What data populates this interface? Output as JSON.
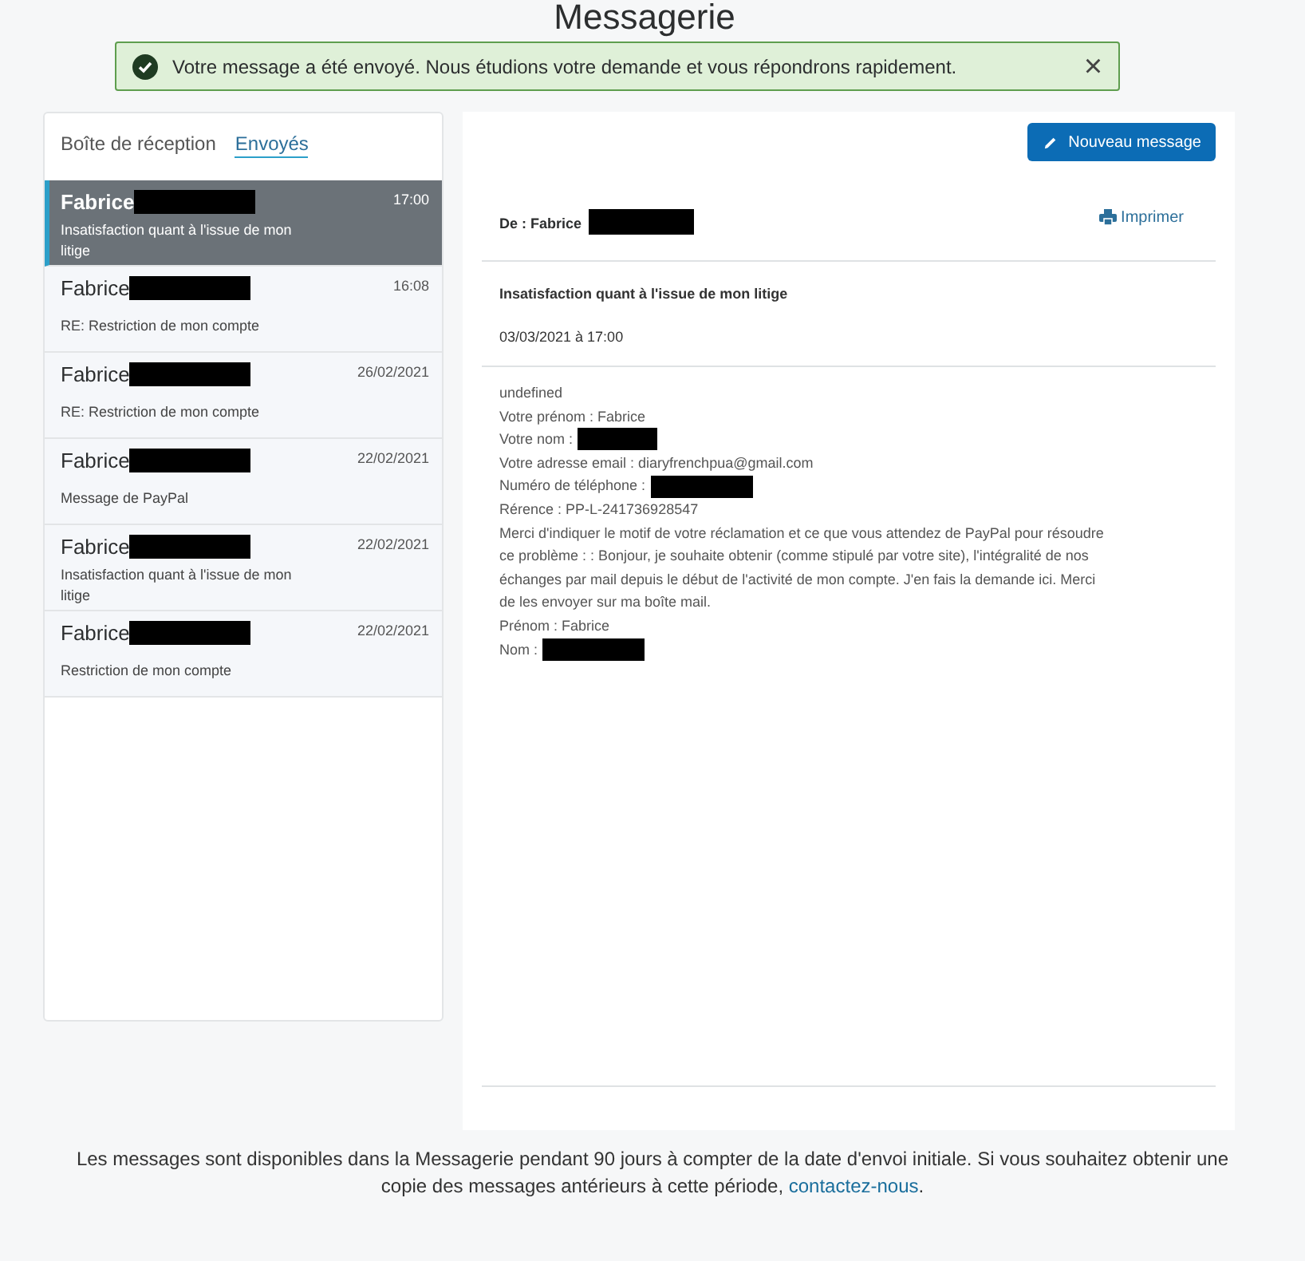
{
  "page": {
    "title": "Messagerie"
  },
  "banner": {
    "text": "Votre message a été envoyé. Nous étudions votre demande et vous répondrons rapidement.",
    "close": "×"
  },
  "tabs": [
    {
      "label": "Boîte de réception",
      "selected": false
    },
    {
      "label": "Envoyés",
      "selected": true
    }
  ],
  "messages": [
    {
      "sender": "Fabrice",
      "redacted": true,
      "time": "17:00",
      "subject": "Insatisfaction quant à l'issue de mon litige",
      "selected": true
    },
    {
      "sender": "Fabrice",
      "redacted": true,
      "time": "16:08",
      "subject": "RE: Restriction de mon compte",
      "selected": false
    },
    {
      "sender": "Fabrice",
      "redacted": true,
      "time": "26/02/2021",
      "subject": "RE: Restriction de mon compte",
      "selected": false
    },
    {
      "sender": "Fabrice",
      "redacted": true,
      "time": "22/02/2021",
      "subject": "Message de PayPal",
      "selected": false
    },
    {
      "sender": "Fabrice",
      "redacted": true,
      "time": "22/02/2021",
      "subject": "Insatisfaction quant à l'issue de mon litige",
      "selected": false
    },
    {
      "sender": "Fabrice",
      "redacted": true,
      "time": "22/02/2021",
      "subject": "Restriction de mon compte",
      "selected": false
    }
  ],
  "new_message_button": "Nouveau message",
  "message": {
    "from": "De : Fabrice",
    "from_redacted": true,
    "print": "Imprimer",
    "subject": "Insatisfaction quant à l'issue de mon litige",
    "date": "03/03/2021 à 17:00",
    "body": [
      {
        "text": "undefined",
        "redacted": false
      },
      {
        "text": "Votre prénom : Fabrice",
        "redacted": false
      },
      {
        "text": "Votre nom :",
        "redacted": true
      },
      {
        "text": "Votre adresse email : diaryfrenchpua@gmail.com",
        "redacted": false
      },
      {
        "text": "Numéro de téléphone :",
        "redacted": true
      },
      {
        "text": "Rérence : PP-L-241736928547",
        "redacted": false
      },
      {
        "text": "Merci d'indiquer le motif de votre réclamation et ce que vous attendez de PayPal pour résoudre ce problème : : Bonjour, je souhaite obtenir (comme stipulé par votre site), l'intégralité de nos échanges par mail depuis le début de l'activité de mon compte. J'en fais la demande ici. Merci de les envoyer sur ma boîte mail.",
        "redacted": false
      },
      {
        "text": "Prénom : Fabrice",
        "redacted": false
      },
      {
        "text": "Nom :",
        "redacted": true
      }
    ]
  },
  "footer": {
    "text": "Les messages sont disponibles dans la Messagerie pendant 90 jours à compter de la date d'envoi initiale. Si vous souhaitez obtenir une copie des messages antérieurs à cette période, ",
    "link": "contactez-nous",
    "after": "."
  }
}
